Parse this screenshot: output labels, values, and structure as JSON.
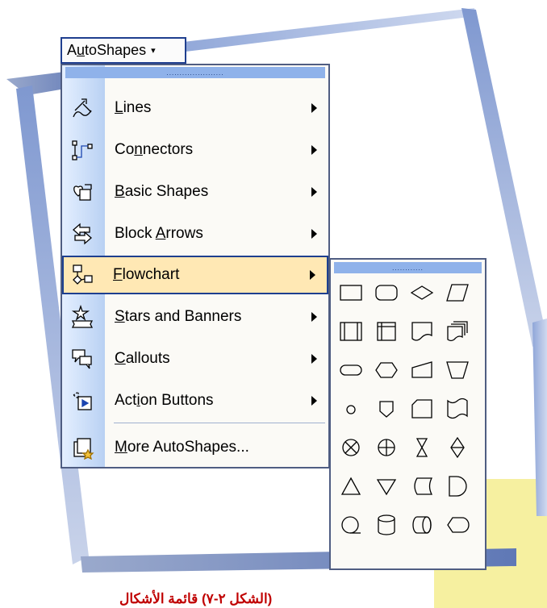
{
  "toolbar": {
    "autoshapes_label_pre": "A",
    "autoshapes_label_u": "u",
    "autoshapes_label_post": "toShapes",
    "dropdown_arrow": "▾"
  },
  "menu": {
    "grip": "......................",
    "items": [
      {
        "pre": "",
        "u": "L",
        "post": "ines",
        "icon": "lines-icon",
        "has_submenu": true
      },
      {
        "pre": "Co",
        "u": "n",
        "post": "nectors",
        "icon": "connectors-icon",
        "has_submenu": true
      },
      {
        "pre": "",
        "u": "B",
        "post": "asic Shapes",
        "icon": "basic-shapes-icon",
        "has_submenu": true
      },
      {
        "pre": "Block ",
        "u": "A",
        "post": "rrows",
        "icon": "block-arrows-icon",
        "has_submenu": true
      },
      {
        "pre": "",
        "u": "F",
        "post": "lowchart",
        "icon": "flowchart-icon",
        "has_submenu": true,
        "active": true
      },
      {
        "pre": "",
        "u": "S",
        "post": "tars and Banners",
        "icon": "stars-banners-icon",
        "has_submenu": true
      },
      {
        "pre": "",
        "u": "C",
        "post": "allouts",
        "icon": "callouts-icon",
        "has_submenu": true
      },
      {
        "pre": "Act",
        "u": "i",
        "post": "on Buttons",
        "icon": "action-buttons-icon",
        "has_submenu": true
      },
      {
        "pre": "",
        "u": "M",
        "post": "ore AutoShapes...",
        "icon": "more-autoshapes-icon",
        "has_submenu": false
      }
    ]
  },
  "submenu": {
    "grip": "............",
    "shapes": [
      "process",
      "alternate-process",
      "decision",
      "data",
      "predefined-process",
      "internal-storage",
      "document",
      "multidocument",
      "terminator",
      "preparation",
      "manual-input",
      "manual-operation",
      "connector",
      "off-page-connector",
      "card",
      "punched-tape",
      "summing-junction",
      "or",
      "collate",
      "sort",
      "extract",
      "merge",
      "stored-data",
      "delay",
      "sequential-access-storage",
      "magnetic-disk",
      "direct-access-storage",
      "display"
    ]
  },
  "caption": "(الشكل ٢-٧) قائمة الأشكال"
}
